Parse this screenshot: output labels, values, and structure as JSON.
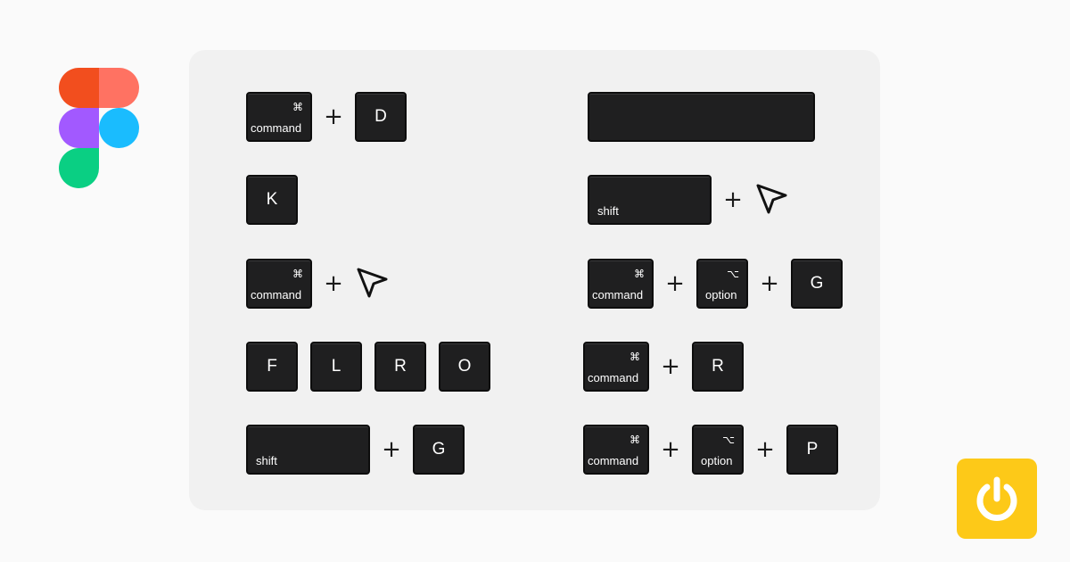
{
  "keys": {
    "command_symbol": "⌘",
    "command_label": "command",
    "option_symbol": "⌥",
    "option_label": "option",
    "shift_label": "shift",
    "plus": "+",
    "D": "D",
    "K": "K",
    "F": "F",
    "L": "L",
    "R": "R",
    "O": "O",
    "G": "G",
    "P": "P"
  },
  "colors": {
    "background": "#fafafa",
    "panel": "#f1f1f1",
    "key": "#1f1f20",
    "key_text": "#ffffff",
    "brand_badge": "#fdc918"
  },
  "icons": [
    "figma-logo",
    "cursor-arrow-icon",
    "power-icon"
  ]
}
